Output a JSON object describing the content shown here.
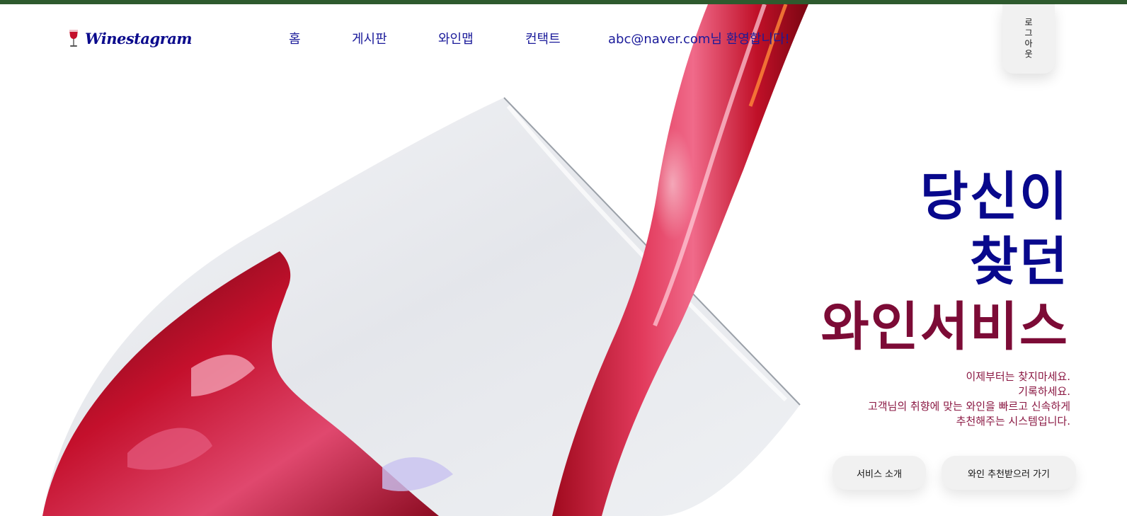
{
  "header": {
    "logo_text": "Winestagram",
    "logo_icon": "wine-glass-icon",
    "nav": [
      {
        "label": "홈"
      },
      {
        "label": "게시판"
      },
      {
        "label": "와인맵"
      },
      {
        "label": "컨택트"
      }
    ],
    "welcome": "abc@naver.com님 환영합니다!",
    "logout_label": "로그아웃"
  },
  "hero": {
    "headline_lines": [
      "당신이",
      "찾던",
      "와인서비스"
    ],
    "subcopy": [
      "이제부터는 찾지마세요.",
      "기록하세요.",
      "고객님의 취향에 맞는 와인을 빠르고 신속하게",
      "추천해주는 시스템입니다."
    ],
    "buttons": {
      "service_intro": "서비스 소개",
      "recommend": "와인 추천받으러 가기"
    }
  },
  "colors": {
    "top_bar": "#2e5a2e",
    "nav_text": "#1a1a9a",
    "headline_blue": "#08088c",
    "headline_wine": "#7c0b36",
    "subcopy": "#8a1742"
  }
}
